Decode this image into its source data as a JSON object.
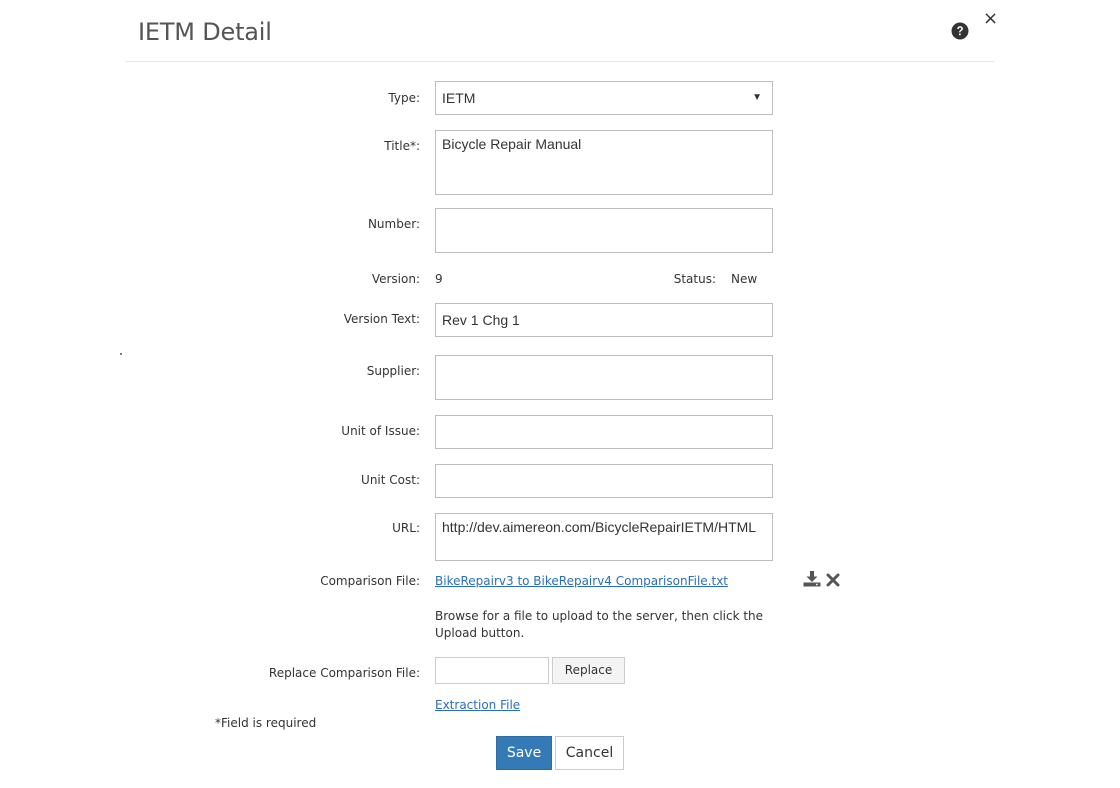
{
  "dialog": {
    "title": "IETM Detail",
    "help_icon": "question-circle-icon",
    "close_icon": "close-x-icon",
    "close_glyph": "×"
  },
  "form": {
    "type": {
      "label": "Type:",
      "selected": "IETM"
    },
    "title": {
      "label": "Title*:",
      "value": "Bicycle Repair Manual"
    },
    "number": {
      "label": "Number:",
      "value": ""
    },
    "version": {
      "label": "Version:",
      "value": "9"
    },
    "status": {
      "label": "Status:",
      "value": "New"
    },
    "version_text": {
      "label": "Version Text:",
      "value": "Rev 1 Chg 1"
    },
    "supplier": {
      "label": "Supplier:",
      "value": ""
    },
    "unit_of_issue": {
      "label": "Unit of Issue:",
      "value": ""
    },
    "unit_cost": {
      "label": "Unit Cost:",
      "value": ""
    },
    "url": {
      "label": "URL:",
      "value": "http://dev.aimereon.com/BicycleRepairIETM/HTML"
    },
    "comparison_file": {
      "label": "Comparison File:",
      "link_text": "BikeRepairv3 to BikeRepairv4 ComparisonFile.txt",
      "download_icon": "download-icon",
      "delete_icon": "delete-x-icon"
    },
    "upload_help": "Browse for a file to upload to the server, then click the Upload button.",
    "replace_comparison": {
      "label": "Replace Comparison File:",
      "button_label": "Replace"
    },
    "extraction_link": "Extraction File",
    "required_note": "*Field is required"
  },
  "actions": {
    "save_label": "Save",
    "cancel_label": "Cancel"
  },
  "colors": {
    "primary": "#337ab7",
    "link": "#2a6ebb",
    "border": "#bdbdbd"
  }
}
